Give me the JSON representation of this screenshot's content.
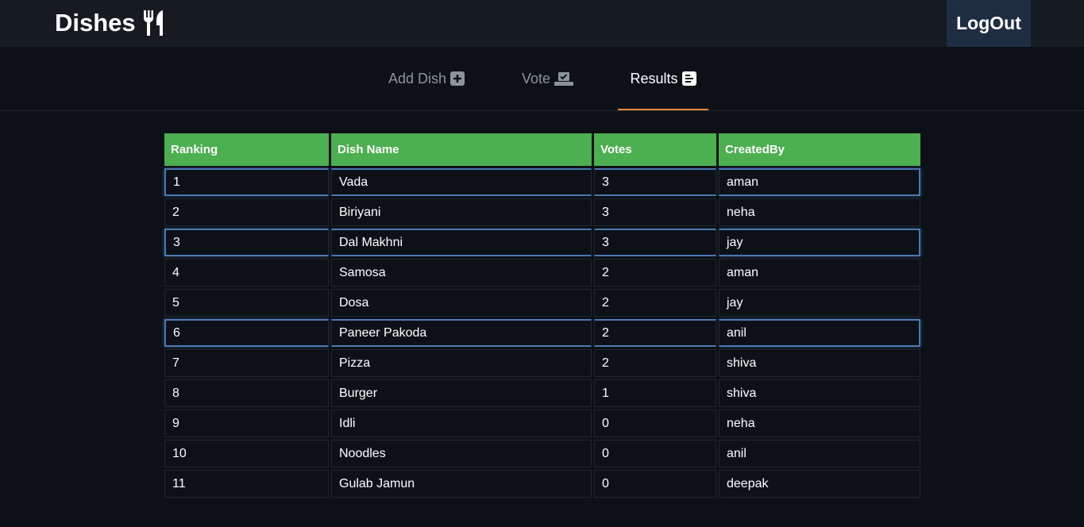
{
  "header": {
    "title": "Dishes",
    "brand_icon": "utensils-icon",
    "logout_label": "LogOut"
  },
  "tabs": [
    {
      "label": "Add Dish",
      "icon": "plus-square-icon",
      "active": false
    },
    {
      "label": "Vote",
      "icon": "ballot-check-icon",
      "active": false
    },
    {
      "label": "Results",
      "icon": "poll-list-icon",
      "active": true
    }
  ],
  "colors": {
    "header_bg": "#4caf50",
    "active_tab_underline": "#f0883e",
    "row_highlight": "#4b78b4"
  },
  "table": {
    "columns": [
      "Ranking",
      "Dish Name",
      "Votes",
      "CreatedBy"
    ],
    "rows": [
      {
        "rank": "1",
        "dish": "Vada",
        "votes": "3",
        "by": "aman",
        "highlighted": true
      },
      {
        "rank": "2",
        "dish": "Biriyani",
        "votes": "3",
        "by": "neha",
        "highlighted": false
      },
      {
        "rank": "3",
        "dish": "Dal Makhni",
        "votes": "3",
        "by": "jay",
        "highlighted": true
      },
      {
        "rank": "4",
        "dish": "Samosa",
        "votes": "2",
        "by": "aman",
        "highlighted": false
      },
      {
        "rank": "5",
        "dish": "Dosa",
        "votes": "2",
        "by": "jay",
        "highlighted": false
      },
      {
        "rank": "6",
        "dish": "Paneer Pakoda",
        "votes": "2",
        "by": "anil",
        "highlighted": true
      },
      {
        "rank": "7",
        "dish": "Pizza",
        "votes": "2",
        "by": "shiva",
        "highlighted": false
      },
      {
        "rank": "8",
        "dish": "Burger",
        "votes": "1",
        "by": "shiva",
        "highlighted": false
      },
      {
        "rank": "9",
        "dish": "Idli",
        "votes": "0",
        "by": "neha",
        "highlighted": false
      },
      {
        "rank": "10",
        "dish": "Noodles",
        "votes": "0",
        "by": "anil",
        "highlighted": false
      },
      {
        "rank": "11",
        "dish": "Gulab Jamun",
        "votes": "0",
        "by": "deepak",
        "highlighted": false
      }
    ]
  }
}
